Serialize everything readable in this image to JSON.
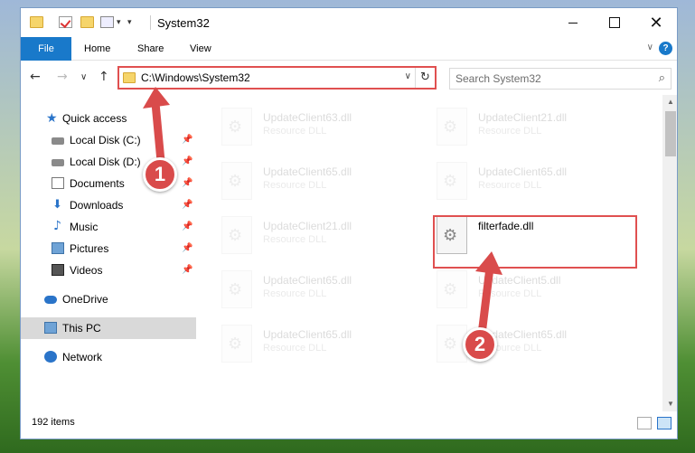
{
  "window": {
    "title": "System32",
    "controls": {
      "minimize": "minimize-icon",
      "maximize": "maximize-icon",
      "close": "✕"
    }
  },
  "ribbon": {
    "tabs": [
      {
        "label": "File",
        "active": true
      },
      {
        "label": "Home"
      },
      {
        "label": "Share"
      },
      {
        "label": "View"
      }
    ],
    "help": "?"
  },
  "navigation": {
    "back": "←",
    "forward": "→",
    "recent": "∨",
    "up": "↑"
  },
  "address": {
    "path": "C:\\Windows\\System32",
    "dropdown": "∨",
    "refresh": "↻"
  },
  "search": {
    "placeholder": "Search System32",
    "icon": "⌕"
  },
  "sidebar": {
    "items": [
      {
        "label": "Quick access",
        "icon": "star-icon",
        "pinned": false
      },
      {
        "label": "Local Disk (C:)",
        "icon": "drive-icon",
        "pinned": true
      },
      {
        "label": "Local Disk (D:)",
        "icon": "drive-icon",
        "pinned": true
      },
      {
        "label": "Documents",
        "icon": "documents-icon",
        "pinned": true
      },
      {
        "label": "Downloads",
        "icon": "download-icon",
        "pinned": true
      },
      {
        "label": "Music",
        "icon": "music-icon",
        "pinned": true
      },
      {
        "label": "Pictures",
        "icon": "pictures-icon",
        "pinned": true
      },
      {
        "label": "Videos",
        "icon": "videos-icon",
        "pinned": true
      },
      {
        "label": "OneDrive",
        "icon": "cloud-icon",
        "pinned": false
      },
      {
        "label": "This PC",
        "icon": "computer-icon",
        "pinned": false,
        "selected": true
      },
      {
        "label": "Network",
        "icon": "network-icon",
        "pinned": false
      }
    ]
  },
  "files": [
    {
      "name": "UpdateClient63.dll",
      "type": "Resource DLL",
      "faded": true
    },
    {
      "name": "UpdateClient21.dll",
      "type": "Resource DLL",
      "faded": true
    },
    {
      "name": "UpdateClient65.dll",
      "type": "Resource DLL",
      "faded": true
    },
    {
      "name": "UpdateClient65.dll",
      "type": "Resource DLL",
      "faded": true
    },
    {
      "name": "UpdateClient21.dll",
      "type": "Resource DLL",
      "faded": true
    },
    {
      "name": "filterfade.dll",
      "type": "",
      "faded": false,
      "highlighted": true
    },
    {
      "name": "UpdateClient65.dll",
      "type": "Resource DLL",
      "faded": true
    },
    {
      "name": "UpdateClient5.dll",
      "type": "Resource DLL",
      "faded": true
    },
    {
      "name": "UpdateClient65.dll",
      "type": "Resource DLL",
      "faded": true
    },
    {
      "name": "UpdateClient65.dll",
      "type": "Resource DLL",
      "faded": true
    }
  ],
  "status": {
    "item_count": "192 items"
  },
  "annotations": [
    {
      "number": "1"
    },
    {
      "number": "2"
    }
  ],
  "colors": {
    "accent": "#1979ca",
    "annotation": "#d94b4b",
    "selection": "#d9d9d9"
  }
}
